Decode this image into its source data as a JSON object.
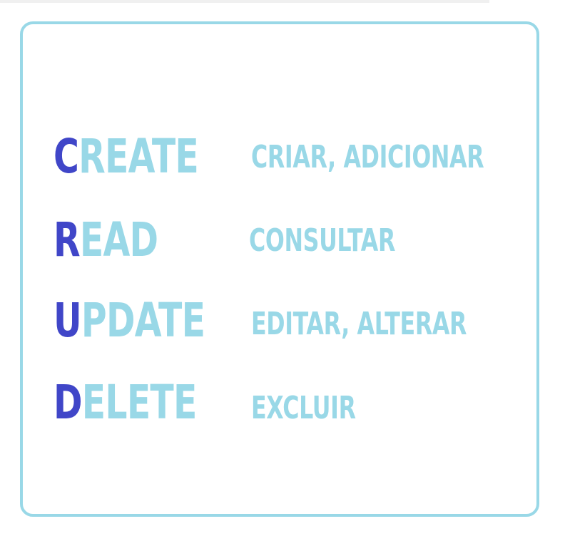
{
  "colors": {
    "accent": "#99d8e7",
    "initial": "#4046c8",
    "background": "#ffffff"
  },
  "rows": [
    {
      "initial": "C",
      "rest": "REATE",
      "translation": "CRIAR, ADICIONAR"
    },
    {
      "initial": "R",
      "rest": "EAD",
      "translation": "CONSULTAR"
    },
    {
      "initial": "U",
      "rest": "PDATE",
      "translation": "EDITAR, ALTERAR"
    },
    {
      "initial": "D",
      "rest": "ELETE",
      "translation": "EXCLUIR"
    }
  ]
}
